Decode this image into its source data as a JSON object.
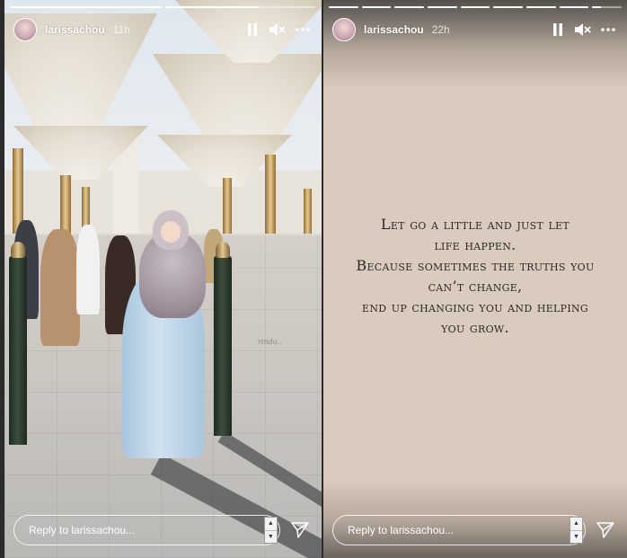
{
  "stories": [
    {
      "id": "left",
      "username": "larissachou",
      "time": "11h",
      "progress": [
        1.0,
        0.62
      ],
      "watermark": "rindu..",
      "reply_placeholder": "Reply to larissachou...",
      "icons": {
        "pause": "pause-icon",
        "mute": "mute-icon",
        "more": "more-icon",
        "send": "send-icon"
      }
    },
    {
      "id": "right",
      "username": "larissachou",
      "time": "22h",
      "progress": [
        1.0,
        1.0,
        1.0,
        1.0,
        1.0,
        1.0,
        1.0,
        1.0,
        0.3
      ],
      "quote_lines": [
        "Let go a little and just let",
        "life happen.",
        "Because sometimes the truths you",
        "can’t change,",
        "end up changing you and helping",
        "you grow."
      ],
      "reply_placeholder": "Reply to larissachou...",
      "icons": {
        "pause": "pause-icon",
        "mute": "mute-icon",
        "more": "more-icon",
        "send": "send-icon"
      }
    }
  ],
  "colors": {
    "story_text_bg": "#d9cbbd",
    "quote_text": "#2c2a27",
    "chrome": "#ffffff"
  }
}
